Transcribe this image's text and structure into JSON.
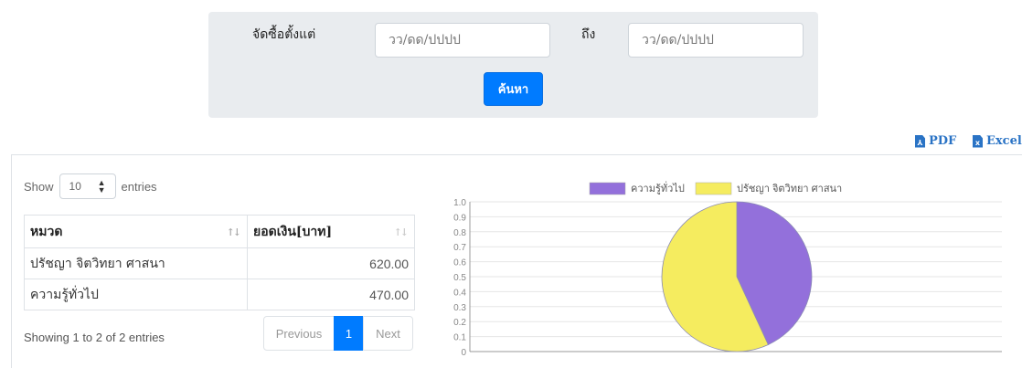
{
  "search": {
    "from_label": "จัดซื้อตั้งแต่",
    "to_label": "ถึง",
    "from_placeholder": "วว/ดด/ปปปป",
    "to_placeholder": "วว/ดด/ปปปป",
    "button_label": "ค้นหา"
  },
  "exports": {
    "pdf_label": "PDF",
    "pdf_icon": "file-pdf-icon",
    "excel_label": "Excel",
    "excel_icon": "file-excel-icon"
  },
  "datatable": {
    "show_label": "Show",
    "entries_label": "entries",
    "page_length": "10",
    "columns": [
      "หมวด",
      "ยอดเงิน[บาท]"
    ],
    "rows": [
      {
        "category": "ปรัชญา จิตวิทยา ศาสนา",
        "amount": "620.00"
      },
      {
        "category": "ความรู้ทั่วไป",
        "amount": "470.00"
      }
    ],
    "info": "Showing 1 to 2 of 2 entries",
    "pager": {
      "previous": "Previous",
      "current": "1",
      "next": "Next"
    }
  },
  "colors": {
    "accent": "#007bff",
    "series_1": "#9370db",
    "series_2": "#f5ec5f"
  },
  "chart_data": {
    "type": "pie",
    "labels": [
      "ความรู้ทั่วไป",
      "ปรัชญา จิตวิทยา ศาสนา"
    ],
    "values": [
      470,
      620
    ],
    "colors": [
      "#9370db",
      "#f5ec5f"
    ],
    "yticks": [
      "1.0",
      "0.9",
      "0.8",
      "0.7",
      "0.6",
      "0.5",
      "0.4",
      "0.3",
      "0.2",
      "0.1",
      "0"
    ],
    "legend_position": "top",
    "grid": true
  }
}
